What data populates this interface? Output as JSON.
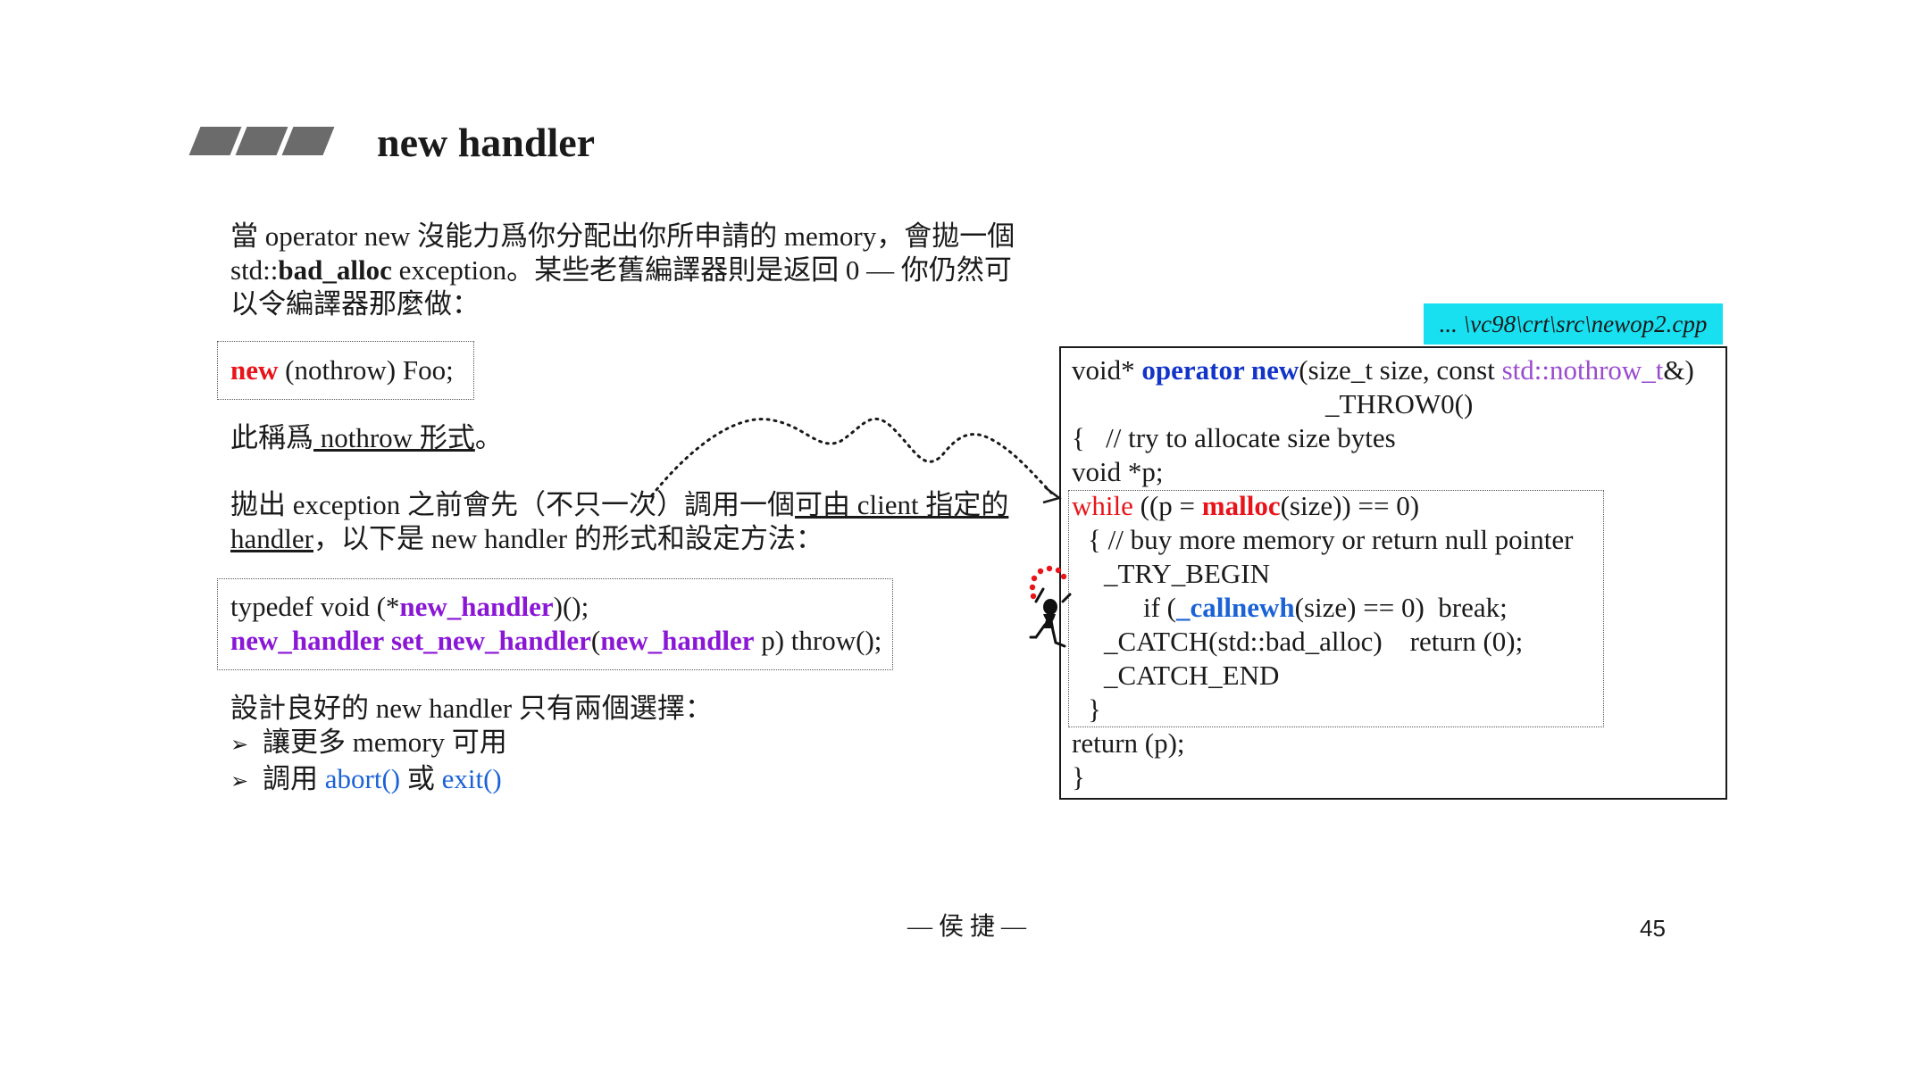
{
  "title": "new handler",
  "intro": {
    "line1": "當 operator new 沒能力爲你分配出你所申請的 memory，會拋一個",
    "line2_a": "std::",
    "line2_b": "bad_alloc",
    "line2_c": " exception。某些老舊編譯器則是返回 0 — 你仍然可",
    "line3": "以令編譯器那麼做："
  },
  "nothrow_example": {
    "keyword": "new",
    "rest": " (nothrow) Foo;"
  },
  "nothrow_note": {
    "prefix": "此稱爲",
    "underlined": " nothrow 形式",
    "suffix": "。"
  },
  "handler_para": {
    "l1_a": "拋出 exception 之前會先（不只一次）調用一個",
    "l1_b": "可由 client 指定的",
    "l2_a": "handler",
    "l2_b": "，以下是 new handler 的形式和設定方法："
  },
  "typedef_box": {
    "l1_a": "typedef void (*",
    "l1_b": "new_handler",
    "l1_c": ")();",
    "l2_a": "new_handler",
    "l2_b": " ",
    "l2_c": "set_new_handler",
    "l2_d": "(",
    "l2_e": "new_handler",
    "l2_f": " p) throw();"
  },
  "design": {
    "heading": "設計良好的 new handler 只有兩個選擇：",
    "bullet_symbol": "➢",
    "item1": "讓更多 memory 可用",
    "item2_a": "調用 ",
    "item2_b": "abort()",
    "item2_c": " 或 ",
    "item2_d": "exit()"
  },
  "source_path": "... \\vc98\\crt\\src\\newop2.cpp",
  "code": {
    "l1_a": "void* ",
    "l1_b": "operator new",
    "l1_c": "(size_t size, const ",
    "l1_d": "std::nothrow_t",
    "l1_e": "&)",
    "l2": "_THROW0()",
    "l3": "{   // try to allocate size bytes",
    "l4": "void *p;",
    "l5_a": "while",
    "l5_b": " ((p = ",
    "l5_c": "malloc",
    "l5_d": "(size)) == 0)",
    "l6": "{ // buy more memory or return null pointer",
    "l7": "_TRY_BEGIN",
    "l8_a": "if (",
    "l8_b": "_callnewh",
    "l8_c": "(size) == 0)  break;",
    "l9": "_CATCH(std::bad_alloc)    return (0);",
    "l10": "_CATCH_END",
    "l11": "}",
    "l12": "return (p);",
    "l13": "}"
  },
  "footer": "— 侯 捷 —",
  "page_number": "45",
  "colors": {
    "keyword_red": "#e8141a",
    "type_purple": "#8a16d6",
    "function_blue": "#1234c8",
    "link_blue": "#1a62d6",
    "path_label_bg": "#18e0f0"
  }
}
